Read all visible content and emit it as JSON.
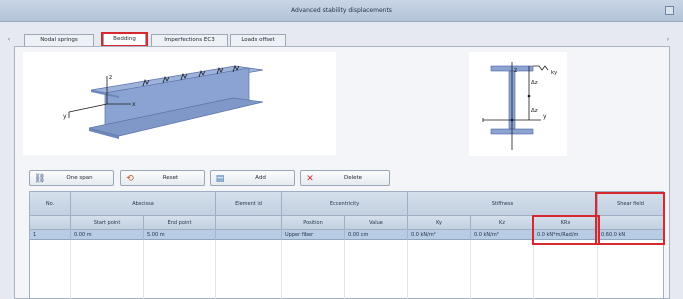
{
  "window": {
    "title": "Advanced stability displacements"
  },
  "tabs": [
    {
      "label": "Nodal springs",
      "active": false,
      "highlighted": false
    },
    {
      "label": "Bedding",
      "active": true,
      "highlighted": true
    },
    {
      "label": "Imperfections EC3",
      "active": false,
      "highlighted": false
    },
    {
      "label": "Loads offset",
      "active": false,
      "highlighted": false
    }
  ],
  "left_diagram": {
    "axis_labels": {
      "z": "z",
      "x": "x",
      "y": "y"
    }
  },
  "right_diagram": {
    "labels": {
      "z": "z",
      "y": "y",
      "dz": "Δz",
      "dzb": "Δz",
      "ky": "ky"
    }
  },
  "toolbar": {
    "buttons": [
      {
        "label": "One span",
        "icon": "beam-icon"
      },
      {
        "label": "Reset",
        "icon": "reset-icon"
      },
      {
        "label": "Add",
        "icon": "add-icon"
      },
      {
        "label": "Delete",
        "icon": "delete-icon"
      }
    ]
  },
  "table": {
    "group_headers": [
      "No.",
      "Abscissa",
      "Element id",
      "Eccentricity",
      "Stiffness",
      "Shear field"
    ],
    "sub_headers": [
      "Start point",
      "End point",
      "Position",
      "Value",
      "Ky",
      "Kz",
      "KRx"
    ],
    "rows": [
      {
        "no": "1",
        "start": "0.00 m",
        "end": "5.00 m",
        "element_id": "",
        "position": "Upper fiber",
        "value": "0.00 cm",
        "ky": "0.0 kN/m²",
        "kz": "0.0 kN/m²",
        "krx": "0.0 kN*m/Rad/m",
        "shear": "0.60.0 kN"
      }
    ]
  },
  "colors": {
    "highlight": "#d7282f",
    "selected_row": "#b8cce4",
    "beam": "#8aa3d2"
  }
}
